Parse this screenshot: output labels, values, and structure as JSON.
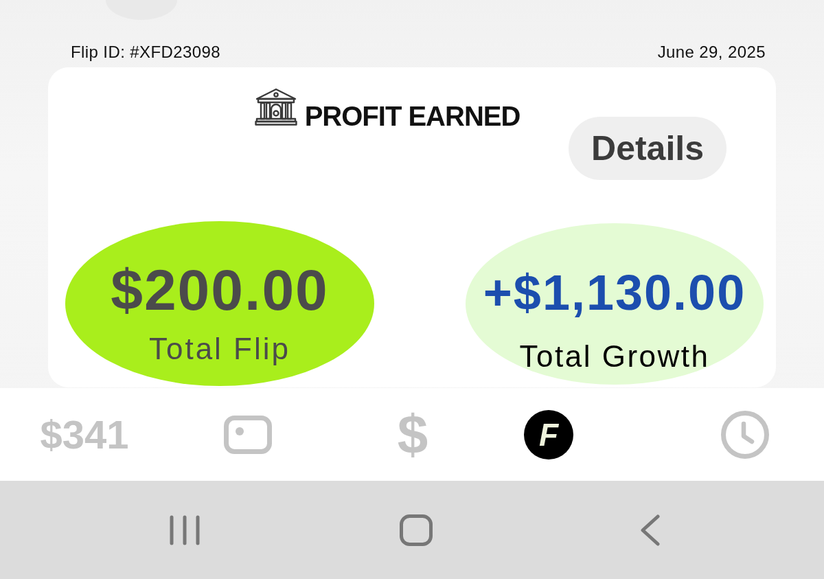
{
  "header": {
    "flip_id": "Flip ID: #XFD23098",
    "date": "June 29, 2025"
  },
  "card": {
    "title": "PROFIT EARNED",
    "details_button": "Details",
    "stats": [
      {
        "kind": "flip",
        "value": "$200.00",
        "label": "Total Flip"
      },
      {
        "kind": "growth",
        "value": "+$1,130.00",
        "label": "Total Growth"
      }
    ]
  },
  "tab_bar": [
    {
      "kind": "balance",
      "label": "$341",
      "selected": false
    },
    {
      "kind": "card",
      "selected": false
    },
    {
      "kind": "glyph",
      "label": "$",
      "selected": false
    },
    {
      "kind": "logo",
      "label": "F",
      "selected": true
    },
    {
      "kind": "clock",
      "selected": false
    }
  ]
}
